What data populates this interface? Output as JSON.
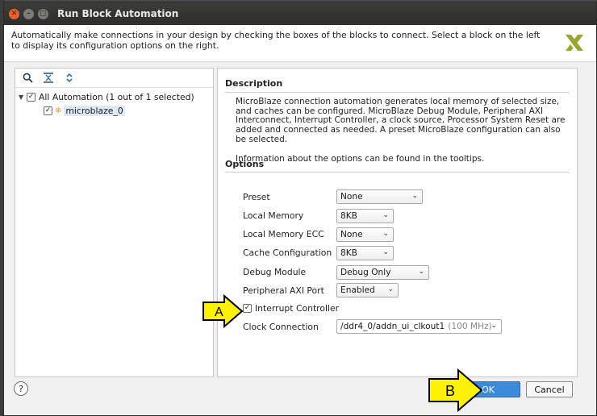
{
  "window": {
    "title": "Run Block Automation"
  },
  "header": {
    "text": "Automatically make connections in your design by checking the boxes of the blocks to connect. Select a block on the left to display its configuration options on the right."
  },
  "tree": {
    "root_label": "All Automation (1 out of 1 selected)",
    "root_checked": true,
    "child_label": "microblaze_0",
    "child_checked": true
  },
  "description": {
    "title": "Description",
    "paragraph1": "MicroBlaze connection automation generates local memory of selected size, and caches can be configured. MicroBlaze Debug Module, Peripheral AXI Interconnect, Interrupt Controller, a clock source, Processor System Reset are added and connected as needed. A preset MicroBlaze configuration can also be selected.",
    "paragraph2": "Information about the options can be found in the tooltips."
  },
  "options": {
    "title": "Options",
    "preset": {
      "label": "Preset",
      "value": "None"
    },
    "local_memory": {
      "label": "Local Memory",
      "value": "8KB"
    },
    "local_memory_ecc": {
      "label": "Local Memory ECC",
      "value": "None"
    },
    "cache_configuration": {
      "label": "Cache Configuration",
      "value": "8KB"
    },
    "debug_module": {
      "label": "Debug Module",
      "value": "Debug Only"
    },
    "peripheral_axi_port": {
      "label": "Peripheral AXI Port",
      "value": "Enabled"
    },
    "interrupt_controller": {
      "label": "Interrupt Controller",
      "checked": true
    },
    "clock_connection": {
      "label": "Clock Connection",
      "value": "/ddr4_0/addn_ui_clkout1",
      "hint": "(100 MHz)"
    }
  },
  "buttons": {
    "help": "?",
    "ok": "OK",
    "cancel": "Cancel"
  },
  "callouts": {
    "a": "A",
    "b": "B"
  },
  "colors": {
    "callout_fill": "#fff200",
    "ok_button": "#3c8ad8",
    "title_bar": "#33322f"
  }
}
